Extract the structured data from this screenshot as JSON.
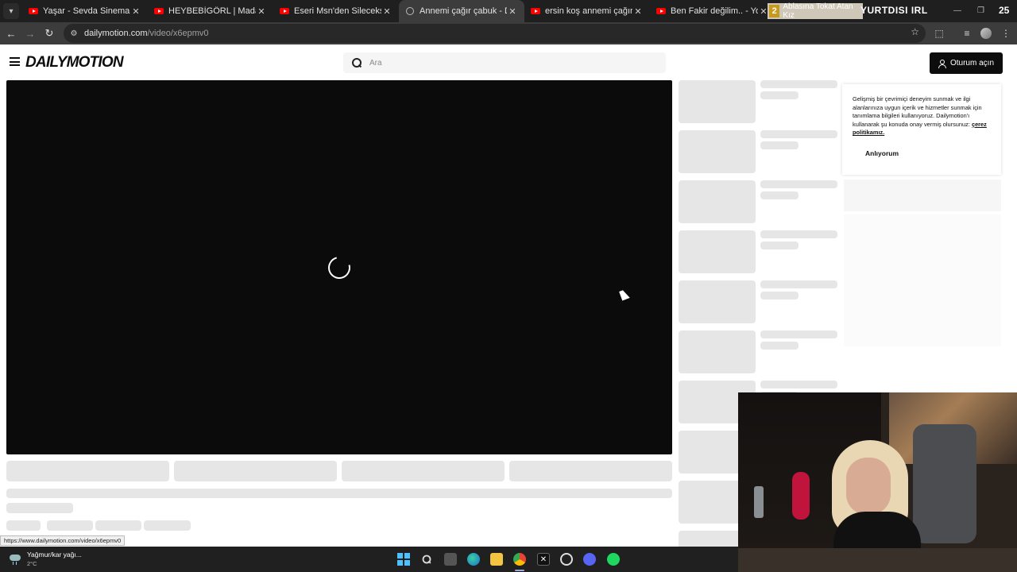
{
  "browser": {
    "tabs": [
      {
        "label": "Yaşar - Sevda Sinemalarda - Yo",
        "favicon": "youtube-icon",
        "active": false
      },
      {
        "label": "HEYBEBİGÖRL | Madara Olduk (",
        "favicon": "youtube-icon",
        "active": false
      },
      {
        "label": "Eseri Msn'den Silecek­sin! - Y",
        "favicon": "youtube-icon",
        "active": false
      },
      {
        "label": "Annemi çağır çabuk - Dailymot",
        "favicon": "dailymotion-icon",
        "active": true
      },
      {
        "label": "ersin koş annemi çağır - YouTu",
        "favicon": "youtube-icon",
        "active": false
      },
      {
        "label": "Ben Fakir değilim.. - YouTube",
        "favicon": "youtube-icon",
        "active": false
      },
      {
        "label": "Ablasına Tokat Atan Kız",
        "favicon": "youtube-icon",
        "active": false
      }
    ],
    "tab_close_glyph": "✕",
    "url_domain": "dailymotion.com",
    "url_path": "/video/x6epmv0",
    "status_url": "https://www.dailymotion.com/video/x6epmv0"
  },
  "stream_overlay": {
    "badge": "2",
    "title": "YURTDISI IRL",
    "number": "25"
  },
  "site": {
    "logo": "DAILYMOTION",
    "search_placeholder": "Ara",
    "signin_label": "Oturum açın"
  },
  "cookie": {
    "text": "Gelişmiş bir çevrimiçi deneyim sunmak ve ilgi alanlarınıza uygun içerik ve hizmetler sunmak için tanımlama bilgileri kullanıyoruz. Dailymotion'ı kullanarak şu konuda onay vermiş olursunuz: ",
    "link": "çerez politikamız.",
    "button": "Anlıyorum"
  },
  "taskbar": {
    "weather_desc": "Yağmur/kar yağı...",
    "weather_temp": "2°C",
    "apps": [
      "start-icon",
      "search-icon",
      "task-view-icon",
      "edge-icon",
      "file-explorer-icon",
      "chrome-icon",
      "x-app-icon",
      "recorder-icon",
      "discord-icon",
      "spotify-icon"
    ]
  },
  "colors": {
    "tabstrip_bg": "#1f1f1f",
    "toolbar_bg": "#3c3c3c",
    "player_bg": "#0b0b0b",
    "skeleton": "#e6e6e6",
    "signin_bg": "#0d0d0d"
  }
}
